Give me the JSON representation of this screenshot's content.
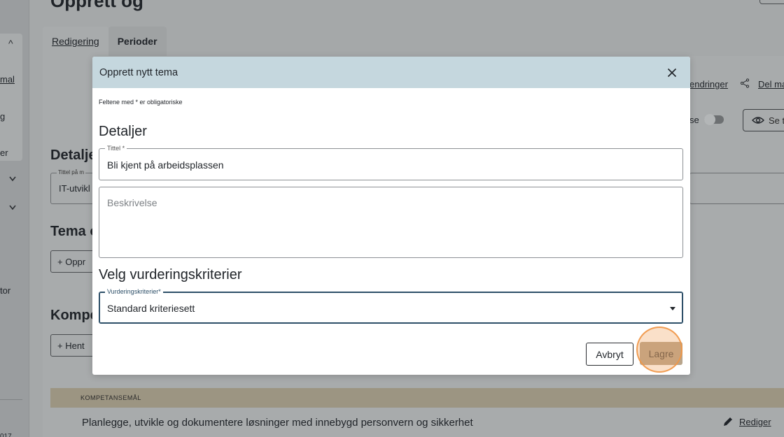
{
  "background": {
    "page_title_fragment": "Opprett og",
    "left_rail": {
      "items": [
        "mal",
        "g",
        "er",
        "tor",
        "017"
      ]
    },
    "tabs": [
      {
        "label": "Redigering",
        "active": true
      },
      {
        "label": "Perioder",
        "active": false
      }
    ],
    "toolbar": {
      "changes_link": "endringer",
      "share_link": "Del ma",
      "toggle_label": "se",
      "see_button": "Se t"
    },
    "sections": {
      "details_heading": "Detalje",
      "title_legend": "Tittel på m",
      "title_value": "IT-utvikl",
      "theme_heading": "Tema o",
      "create_button": "+ Oppr",
      "competence_heading": "Kompe",
      "fetch_button": "+ Hent"
    },
    "competence_table": {
      "header": "KOMPETANSEMÅL",
      "rows": [
        {
          "text": "Planlegge, utvikle og dokumentere løsninger med innebygd personvern og sikkerhet",
          "action": "Rediger"
        }
      ]
    }
  },
  "modal": {
    "title": "Opprett nytt tema",
    "required_note": "Feltene med * er obligatoriske",
    "details_heading": "Detaljer",
    "title_field": {
      "legend": "Tittel *",
      "value": "Bli kjent på arbeidsplassen"
    },
    "description_field": {
      "placeholder": "Beskrivelse",
      "value": ""
    },
    "criteria_heading": "Velg vurderingskriterier",
    "criteria_field": {
      "legend": "Vurderingskriterier*",
      "selected": "Standard kriteriesett"
    },
    "cancel_label": "Avbryt",
    "save_label": "Lagre"
  },
  "colors": {
    "modal_header": "#c5d7de",
    "save_button": "#b8a58c",
    "overlay": "#a5a8a9",
    "click_highlight": "#f0a05a"
  }
}
